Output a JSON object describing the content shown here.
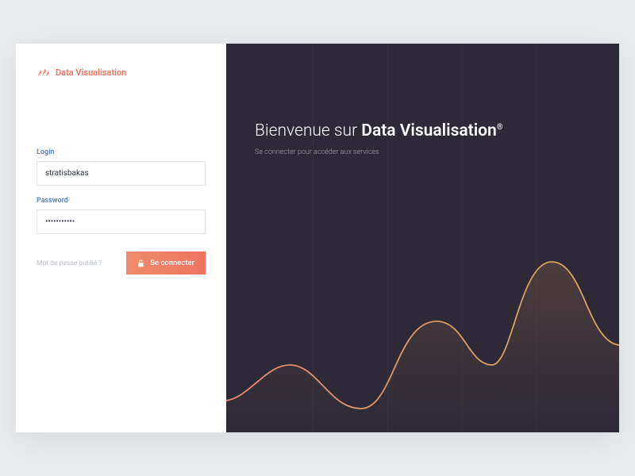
{
  "brand": {
    "name": "Data Visualisation"
  },
  "form": {
    "login_label": "Login",
    "login_value": "stratisbakas",
    "password_label": "Password",
    "password_value": "•••••••••••",
    "forgot_link": "Mot de passe oublié ?",
    "submit_label": "Se connecter"
  },
  "hero": {
    "title_prefix": "Bienvenue sur ",
    "title_strong": "Data Visualisation",
    "title_suffix": "®",
    "subtitle": "Se connecter pour accéder aux services"
  },
  "colors": {
    "primary": "#f0735c",
    "dark_bg": "#2d2936",
    "wave_start": "#e88a6a",
    "wave_end": "#d8a860"
  }
}
